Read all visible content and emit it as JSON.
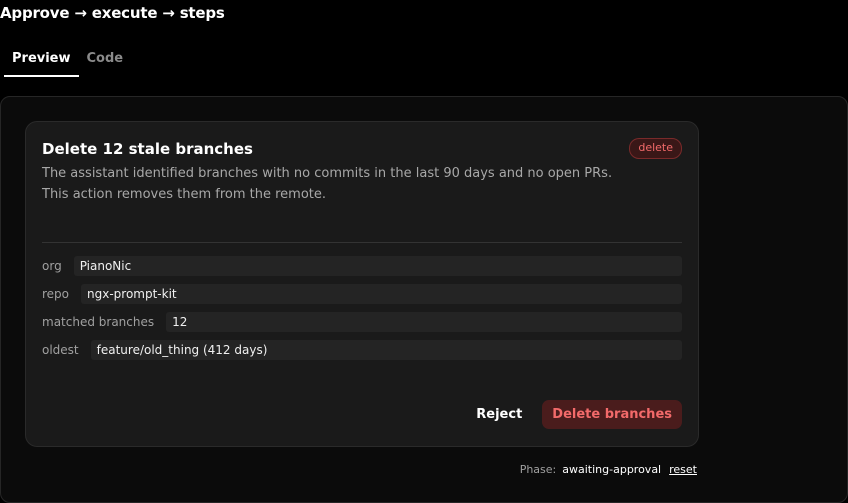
{
  "page": {
    "title": "Approve → execute → steps"
  },
  "tabs": [
    {
      "label": "Preview",
      "active": true
    },
    {
      "label": "Code",
      "active": false
    }
  ],
  "card": {
    "title": "Delete 12 stale branches",
    "badge": "delete",
    "description": "The assistant identified branches with no commits in the last 90 days and no open PRs. This action removes them from the remote.",
    "fields": [
      {
        "label": "org",
        "value": "PianoNic"
      },
      {
        "label": "repo",
        "value": "ngx-prompt-kit"
      },
      {
        "label": "matched branches",
        "value": "12"
      },
      {
        "label": "oldest",
        "value": "feature/old_thing (412 days)"
      }
    ],
    "actions": {
      "reject_label": "Reject",
      "confirm_label": "Delete branches"
    }
  },
  "status": {
    "phase_label": "Phase:",
    "phase_value": "awaiting-approval",
    "reset_label": "reset"
  },
  "colors": {
    "background": "#000000",
    "card": "#1a1a1a",
    "danger": "#f26a6a",
    "danger_bg": "#4a1c1c"
  }
}
